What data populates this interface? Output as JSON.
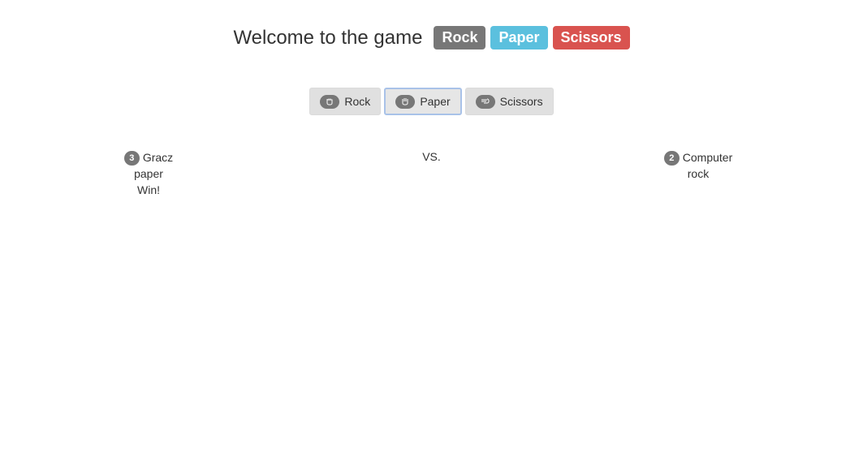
{
  "header": {
    "welcome_text": "Welcome to the game",
    "labels": [
      {
        "text": "Rock",
        "color": "#777777"
      },
      {
        "text": "Paper",
        "color": "#5bc0de"
      },
      {
        "text": "Scissors",
        "color": "#d9534f"
      }
    ]
  },
  "choices": [
    {
      "label": "Rock",
      "icon": "fist-icon",
      "active": false
    },
    {
      "label": "Paper",
      "icon": "hand-icon",
      "active": true
    },
    {
      "label": "Scissors",
      "icon": "scissors-hand-icon",
      "active": false
    }
  ],
  "player": {
    "score": "3",
    "name": "Gracz",
    "choice": "paper",
    "result": "Win!"
  },
  "vs_text": "VS.",
  "computer": {
    "score": "2",
    "name": "Computer",
    "choice": "rock"
  }
}
